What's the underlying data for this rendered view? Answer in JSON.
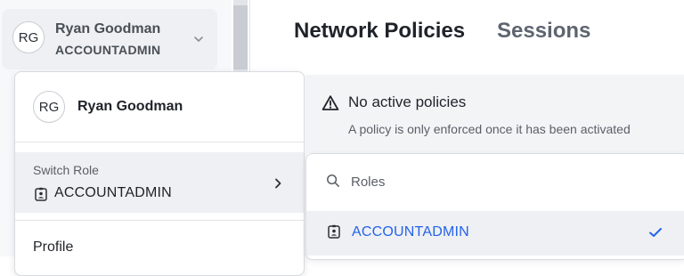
{
  "user": {
    "initials": "RG",
    "name": "Ryan Goodman",
    "role": "ACCOUNTADMIN"
  },
  "menu": {
    "initials": "RG",
    "name": "Ryan Goodman",
    "switch_role_label": "Switch Role",
    "current_role": "ACCOUNTADMIN",
    "profile_label": "Profile"
  },
  "tabs": [
    {
      "label": "Network Policies",
      "active": true
    },
    {
      "label": "Sessions",
      "active": false
    }
  ],
  "banner": {
    "title": "No active policies",
    "subtitle": "A policy is only enforced once it has been activated",
    "icon": "warning-triangle-icon"
  },
  "roles_dropdown": {
    "search_placeholder": "Roles",
    "options": [
      {
        "label": "ACCOUNTADMIN",
        "selected": true
      }
    ]
  },
  "colors": {
    "accent": "#2563eb",
    "selected_bg": "#eef0f3",
    "banner_bg": "#f3f4f6"
  }
}
